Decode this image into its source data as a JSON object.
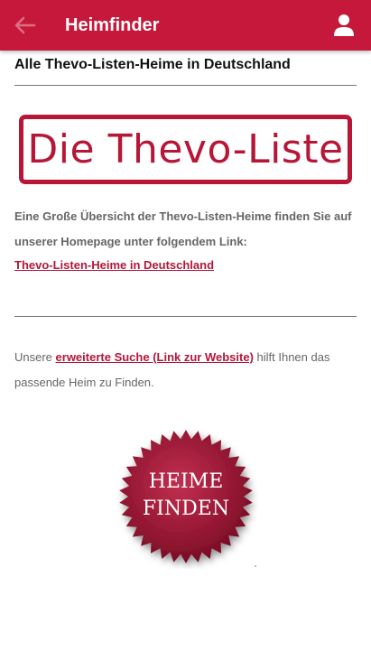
{
  "app_bar": {
    "title": "Heimfinder",
    "back_icon": "arrow-left-icon",
    "profile_icon": "user-icon",
    "color": "#c6183a"
  },
  "main": {
    "heading": "Alle Thevo-Listen-Heime in Deutschland",
    "logo_text": "Die Thevo-Liste",
    "intro_text": "Eine Große Übersicht der Thevo-Listen-Heime finden Sie auf unserer Homepage unter folgendem Link:",
    "list_link": "Thevo-Listen-Heime in Deutschland",
    "search_prefix": "Unsere ",
    "search_link": "erweiterte Suche (Link zur Website)",
    "search_suffix": " hilft Ihnen das passende Heim zu Finden.",
    "seal_line1": "HEIME",
    "seal_line2": "FINDEN",
    "accent_color": "#b2173a"
  }
}
